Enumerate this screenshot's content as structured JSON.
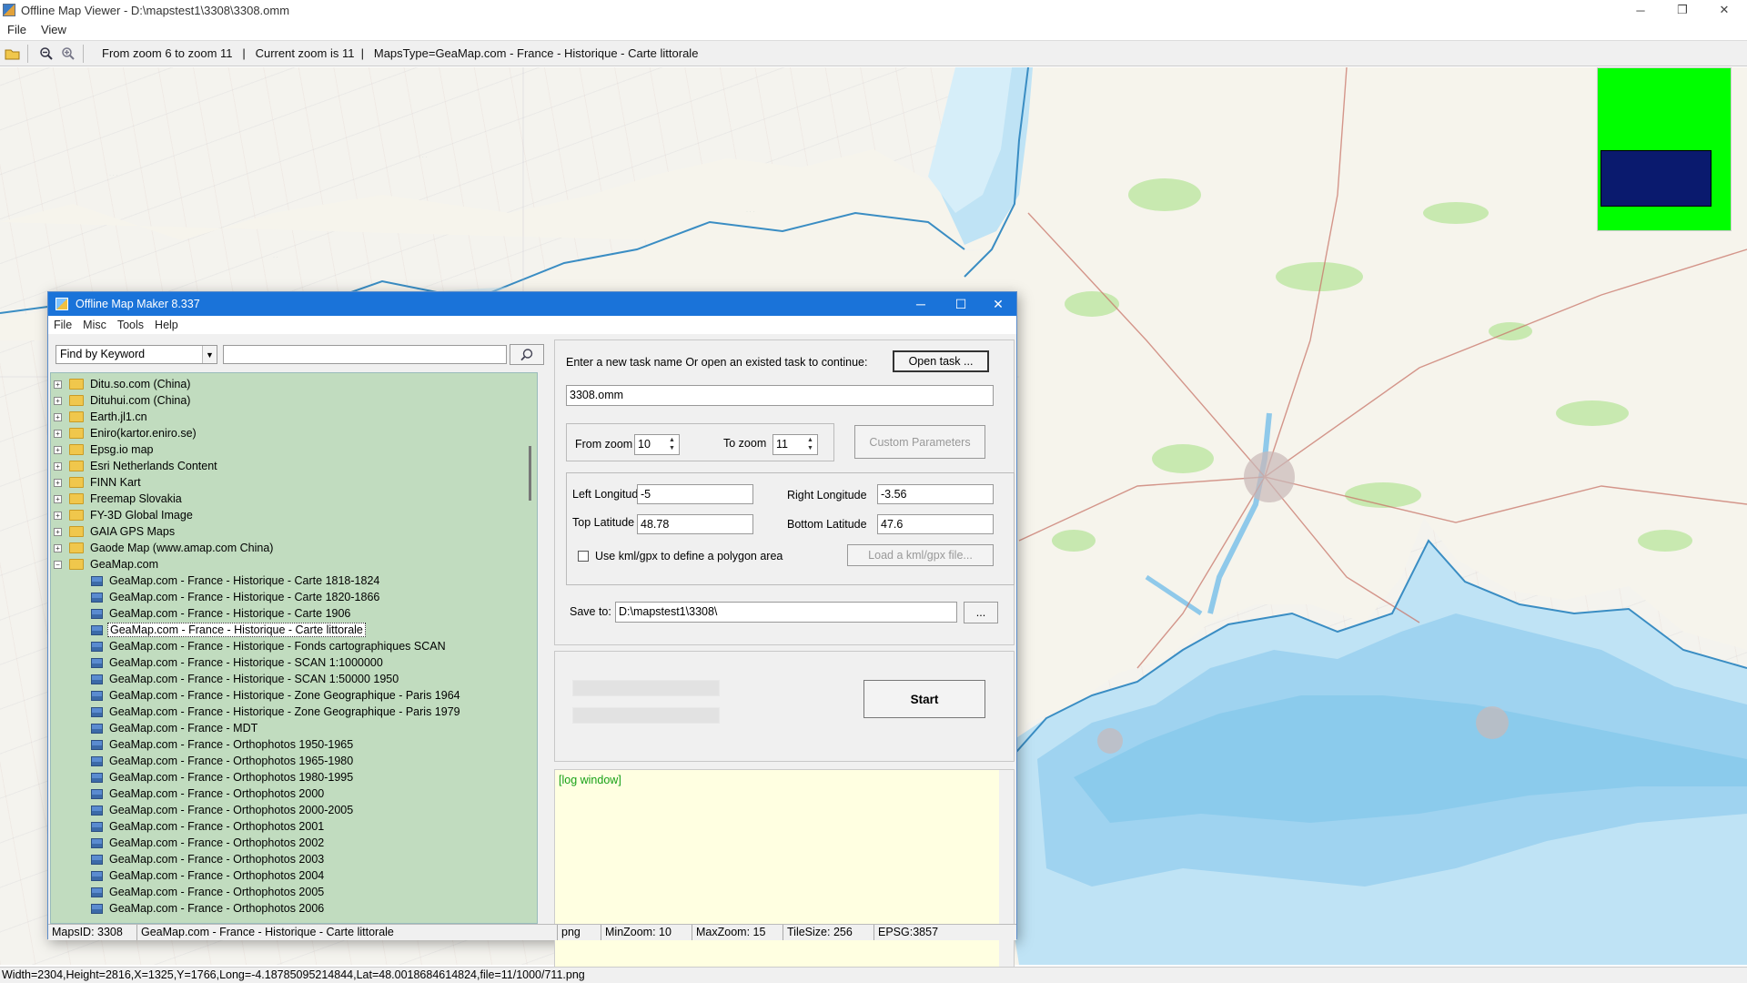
{
  "window": {
    "title": "Offline Map Viewer - D:\\mapstest1\\3308\\3308.omm",
    "minimize": "─",
    "maximize": "❐",
    "close": "✕"
  },
  "menu": [
    "File",
    "View"
  ],
  "toolbar": {
    "open_icon": "folder-open-icon",
    "zoom_out_icon": "zoom-out-icon",
    "zoom_in_icon": "zoom-in-icon",
    "info": "From zoom 6 to zoom 11   |   Current zoom is 11  |   MapsType=GeaMap.com - France - Historique - Carte littorale"
  },
  "status": "Width=2304,Height=2816,X=1325,Y=1766,Long=-4.18785095214844,Lat=48.0018684614824,file=11/1000/711.png",
  "colors": {
    "sea": "#bfe3f5",
    "deep_sea": "#7fc6ea",
    "minimap_bg": "#00ff00",
    "minimap_view": "#0a1a6e",
    "dialog_title": "#1a73d9",
    "tree_bg": "#c1dcbf",
    "log_bg": "#ffffe1"
  },
  "dialog": {
    "title": "Offline Map Maker 8.337",
    "minimize": "─",
    "maximize": "☐",
    "close": "✕",
    "menu": [
      "File",
      "Misc",
      "Tools",
      "Help"
    ],
    "search_mode": "Find by Keyword",
    "search_value": "",
    "tree": [
      {
        "label": "Ditu.so.com (China)",
        "type": "folder",
        "expander": "+"
      },
      {
        "label": "Dituhui.com (China)",
        "type": "folder",
        "expander": "+"
      },
      {
        "label": "Earth.jl1.cn",
        "type": "folder",
        "expander": "+"
      },
      {
        "label": "Eniro(kartor.eniro.se)",
        "type": "folder",
        "expander": "+"
      },
      {
        "label": "Epsg.io map",
        "type": "folder",
        "expander": "+"
      },
      {
        "label": "Esri Netherlands Content",
        "type": "folder",
        "expander": "+"
      },
      {
        "label": "FINN Kart",
        "type": "folder",
        "expander": "+"
      },
      {
        "label": "Freemap Slovakia",
        "type": "folder",
        "expander": "+"
      },
      {
        "label": "FY-3D Global Image",
        "type": "folder",
        "expander": "+"
      },
      {
        "label": "GAIA GPS Maps",
        "type": "folder",
        "expander": "+"
      },
      {
        "label": "Gaode Map (www.amap.com China)",
        "type": "folder",
        "expander": "+"
      },
      {
        "label": "GeaMap.com",
        "type": "folder",
        "expander": "−"
      },
      {
        "label": "GeaMap.com - France - Historique - Carte 1818-1824",
        "type": "leaf"
      },
      {
        "label": "GeaMap.com - France - Historique - Carte 1820-1866",
        "type": "leaf"
      },
      {
        "label": "GeaMap.com - France - Historique - Carte 1906",
        "type": "leaf"
      },
      {
        "label": "GeaMap.com - France - Historique - Carte littorale",
        "type": "leaf",
        "selected": true
      },
      {
        "label": "GeaMap.com - France - Historique - Fonds cartographiques SCAN",
        "type": "leaf"
      },
      {
        "label": "GeaMap.com - France - Historique - SCAN 1:1000000",
        "type": "leaf"
      },
      {
        "label": "GeaMap.com - France - Historique - SCAN 1:50000 1950",
        "type": "leaf"
      },
      {
        "label": "GeaMap.com - France - Historique - Zone Geographique - Paris 1964",
        "type": "leaf"
      },
      {
        "label": "GeaMap.com - France - Historique - Zone Geographique - Paris 1979",
        "type": "leaf"
      },
      {
        "label": "GeaMap.com - France - MDT",
        "type": "leaf"
      },
      {
        "label": "GeaMap.com - France - Orthophotos 1950-1965",
        "type": "leaf"
      },
      {
        "label": "GeaMap.com - France - Orthophotos 1965-1980",
        "type": "leaf"
      },
      {
        "label": "GeaMap.com - France - Orthophotos 1980-1995",
        "type": "leaf"
      },
      {
        "label": "GeaMap.com - France - Orthophotos 2000",
        "type": "leaf"
      },
      {
        "label": "GeaMap.com - France - Orthophotos 2000-2005",
        "type": "leaf"
      },
      {
        "label": "GeaMap.com - France - Orthophotos 2001",
        "type": "leaf"
      },
      {
        "label": "GeaMap.com - France - Orthophotos 2002",
        "type": "leaf"
      },
      {
        "label": "GeaMap.com - France - Orthophotos 2003",
        "type": "leaf"
      },
      {
        "label": "GeaMap.com - France - Orthophotos 2004",
        "type": "leaf"
      },
      {
        "label": "GeaMap.com - France - Orthophotos 2005",
        "type": "leaf"
      },
      {
        "label": "GeaMap.com - France - Orthophotos 2006",
        "type": "leaf"
      }
    ],
    "task_prompt": "Enter a new task name Or open an existed task to continue:",
    "open_task": "Open task ...",
    "task_name": "3308.omm",
    "from_zoom_label": "From zoom",
    "from_zoom": "10",
    "to_zoom_label": "To zoom",
    "to_zoom": "11",
    "custom_params": "Custom Parameters",
    "left_lon_label": "Left Longitude",
    "left_lon": "-5",
    "right_lon_label": "Right Longitude",
    "right_lon": "-3.56",
    "top_lat_label": "Top Latitude",
    "top_lat": "48.78",
    "bottom_lat_label": "Bottom Latitude",
    "bottom_lat": "47.6",
    "kml_checkbox": "Use kml/gpx to define a polygon area",
    "load_kml": "Load a kml/gpx file...",
    "save_to_label": "Save to:",
    "save_to": "D:\\mapstest1\\3308\\",
    "browse": "...",
    "start": "Start",
    "log": "[log window]",
    "status": {
      "maps_id": "MapsID: 3308",
      "map_name": "GeaMap.com - France - Historique - Carte littorale",
      "format": "png",
      "min_zoom": "MinZoom: 10",
      "max_zoom": "MaxZoom: 15",
      "tile_size": "TileSize: 256",
      "epsg": "EPSG:3857"
    }
  }
}
